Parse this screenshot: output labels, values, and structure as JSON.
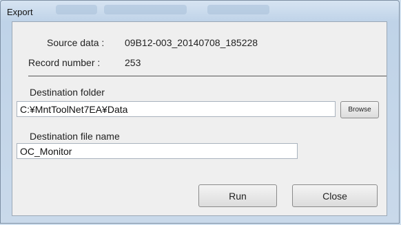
{
  "window": {
    "title": "Export"
  },
  "info": {
    "source_label": "Source data :",
    "source_value": "09B12-003_20140708_185228",
    "record_label": "Record number :",
    "record_value": "253"
  },
  "destination_folder": {
    "label": "Destination folder",
    "value": "C:¥MntToolNet7EA¥Data",
    "browse_label": "Browse"
  },
  "destination_file": {
    "label": "Destination file name",
    "value": "OC_Monitor"
  },
  "buttons": {
    "run": "Run",
    "close": "Close"
  }
}
